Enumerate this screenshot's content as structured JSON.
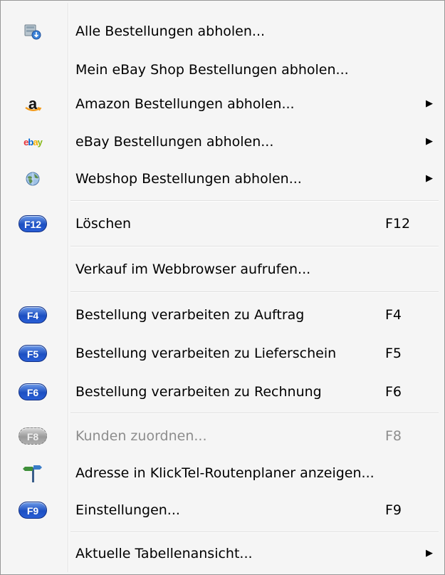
{
  "menu": {
    "items": [
      {
        "label": "Alle Bestellungen abholen...",
        "icon": "server-download-icon"
      },
      {
        "label": "Mein eBay Shop Bestellungen abholen..."
      },
      {
        "label": "Amazon Bestellungen abholen...",
        "icon": "amazon-icon",
        "submenu": true
      },
      {
        "label": "eBay Bestellungen abholen...",
        "icon": "ebay-icon",
        "submenu": true
      },
      {
        "label": "Webshop Bestellungen abholen...",
        "icon": "globe-icon",
        "submenu": true
      },
      {
        "label": "Löschen",
        "icon": "f12-key-icon",
        "key_badge": "F12",
        "shortcut": "F12"
      },
      {
        "label": "Verkauf im Webbrowser aufrufen..."
      },
      {
        "label": "Bestellung verarbeiten zu Auftrag",
        "icon": "f4-key-icon",
        "key_badge": "F4",
        "shortcut": "F4"
      },
      {
        "label": "Bestellung verarbeiten zu Lieferschein",
        "icon": "f5-key-icon",
        "key_badge": "F5",
        "shortcut": "F5"
      },
      {
        "label": "Bestellung verarbeiten zu Rechnung",
        "icon": "f6-key-icon",
        "key_badge": "F6",
        "shortcut": "F6"
      },
      {
        "label": "Kunden zuordnen...",
        "icon": "f8-key-icon",
        "key_badge": "F8",
        "shortcut": "F8",
        "disabled": true
      },
      {
        "label": "Adresse in KlickTel-Routenplaner anzeigen...",
        "icon": "signpost-icon"
      },
      {
        "label": "Einstellungen...",
        "icon": "f9-key-icon",
        "key_badge": "F9",
        "shortcut": "F9"
      },
      {
        "label": "Aktuelle Tabellenansicht...",
        "submenu": true
      }
    ],
    "submenu_arrow": "▶"
  },
  "logos": {
    "amazon_letter": "a",
    "ebay_e": "e",
    "ebay_b": "b",
    "ebay_a": "a",
    "ebay_y": "y"
  },
  "colors": {
    "menu_background": "#f5f5f5",
    "fkey_blue": "#1c4fc2",
    "disabled_text": "#8d8d8d"
  }
}
